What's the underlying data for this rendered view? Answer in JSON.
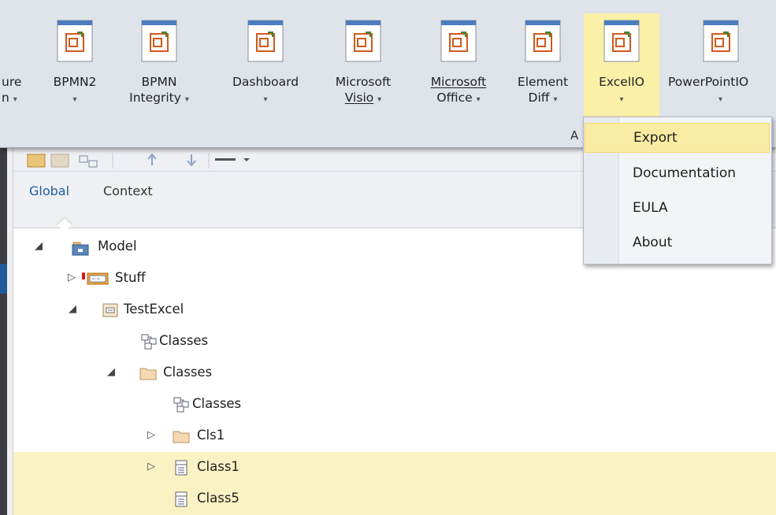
{
  "ribbon": {
    "buttons": [
      {
        "line1": "ure",
        "line2": "n",
        "chevron": "▾",
        "partial": true
      },
      {
        "line1": "BPMN2",
        "line2": "",
        "chevron": "▾"
      },
      {
        "line1": "BPMN",
        "line2": "Integrity",
        "chevron": "▾"
      },
      {
        "line1": "Dashboard",
        "line2": "",
        "chevron": "▾"
      },
      {
        "line1": "Microsoft",
        "line2": "Visio",
        "chevron": "▾"
      },
      {
        "line1": "Microsoft",
        "line2": "Office",
        "chevron": "▾"
      },
      {
        "line1": "Element",
        "line2": "Diff",
        "chevron": "▾"
      },
      {
        "line1": "ExcelIO",
        "line2": "",
        "chevron": "▾",
        "active": true
      },
      {
        "line1": "PowerPointIO",
        "line2": "",
        "chevron": "▾"
      }
    ],
    "group_label": "A",
    "icon": "addin-plugin-icon",
    "active_color": "#fbf0a8"
  },
  "tabs": {
    "global": "Global",
    "context": "Context"
  },
  "dropdown": {
    "items": [
      "Export",
      "Documentation",
      "EULA",
      "About"
    ],
    "hover_color": "#fbeca4"
  },
  "tree": {
    "nodes": [
      {
        "label": "Model",
        "icon": "model-package-icon",
        "expander": "expanded"
      },
      {
        "label": "Stuff",
        "icon": "diagram-package-icon",
        "expander": "collapsed"
      },
      {
        "label": "TestExcel",
        "icon": "package-icon",
        "expander": "expanded"
      },
      {
        "label": "Classes",
        "icon": "class-diagram-icon",
        "expander": "none"
      },
      {
        "label": "Classes",
        "icon": "folder-icon",
        "expander": "expanded"
      },
      {
        "label": "Classes",
        "icon": "class-diagram-icon",
        "expander": "none"
      },
      {
        "label": "Cls1",
        "icon": "folder-icon",
        "expander": "collapsed"
      },
      {
        "label": "Class1",
        "icon": "class-element-icon",
        "expander": "collapsed",
        "selected": true
      },
      {
        "label": "Class5",
        "icon": "class-element-icon",
        "expander": "none",
        "selected": true
      }
    ],
    "selection_color": "#fbf2c4"
  }
}
